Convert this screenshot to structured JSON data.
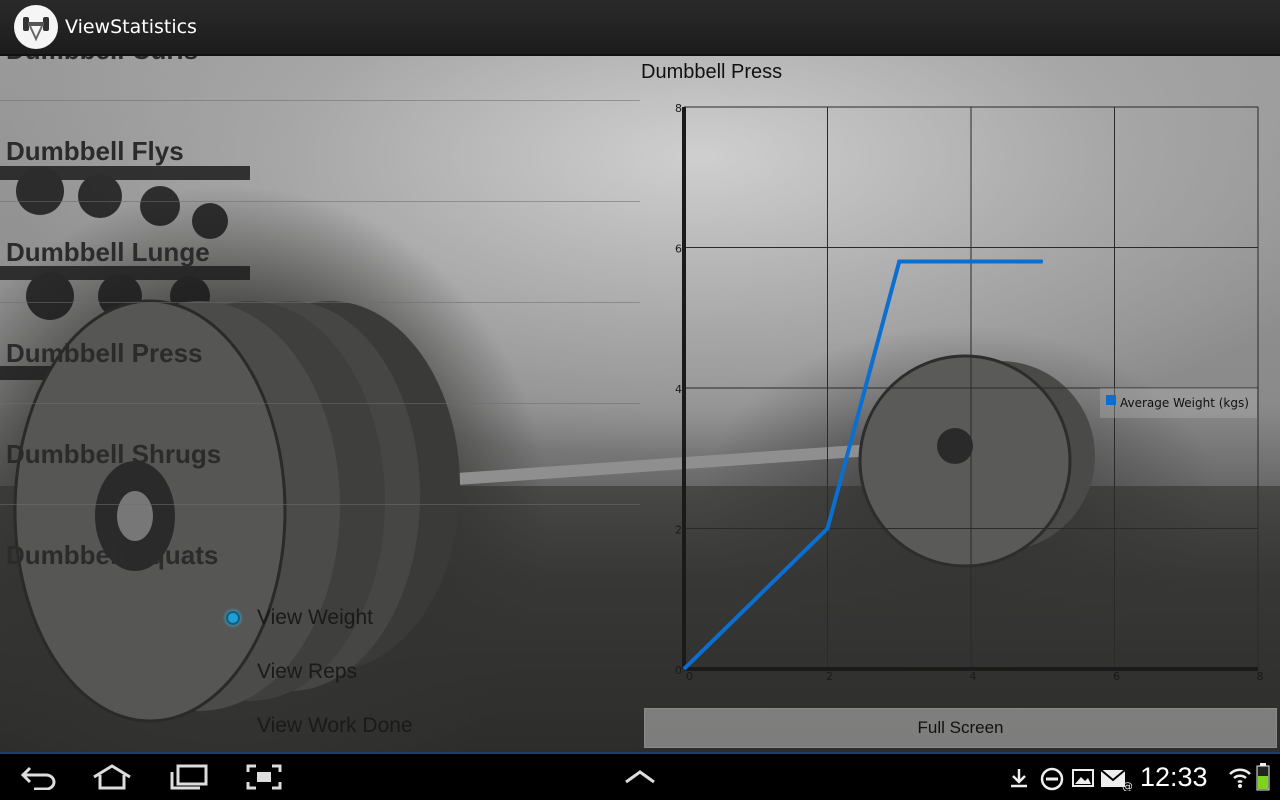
{
  "app": {
    "title": "ViewStatistics",
    "icon": "dumbbell-logo-icon"
  },
  "exercise_list": {
    "items": [
      {
        "label": "Dumbbell Curls"
      },
      {
        "label": "Dumbbell Flys"
      },
      {
        "label": "Dumbbell Lunge"
      },
      {
        "label": "Dumbbell Press"
      },
      {
        "label": "Dumbbell Shrugs"
      },
      {
        "label": "Dumbbell Squats"
      }
    ]
  },
  "view_options": {
    "options": [
      {
        "label": "View Weight",
        "selected": true
      },
      {
        "label": "View Reps",
        "selected": false
      },
      {
        "label": "View Work Done",
        "selected": false
      }
    ]
  },
  "chart_data": {
    "type": "line",
    "title": "Dumbbell Press",
    "xlabel": "",
    "ylabel": "",
    "xlim": [
      0,
      8
    ],
    "ylim": [
      0,
      8
    ],
    "xticks": [
      "0",
      "2",
      "4",
      "6",
      "8"
    ],
    "yticks": [
      "0",
      "2",
      "4",
      "6",
      "8"
    ],
    "grid": true,
    "legend_position": "right",
    "series": [
      {
        "name": "Average Weight (kgs)",
        "color": "#0a6fd0",
        "points": [
          [
            0,
            0
          ],
          [
            2,
            2
          ],
          [
            3,
            5.8
          ],
          [
            4,
            5.8
          ],
          [
            5,
            5.8
          ]
        ]
      }
    ]
  },
  "buttons": {
    "full_screen": "Full Screen"
  },
  "status_bar": {
    "time": "12:33",
    "icons": [
      "download-icon",
      "do-not-disturb-icon",
      "gallery-icon",
      "email-icon",
      "wifi-icon",
      "battery-icon"
    ]
  },
  "navigation": {
    "buttons": [
      "back-icon",
      "home-icon",
      "recent-apps-icon",
      "screenshot-icon",
      "chevron-up-icon"
    ]
  }
}
